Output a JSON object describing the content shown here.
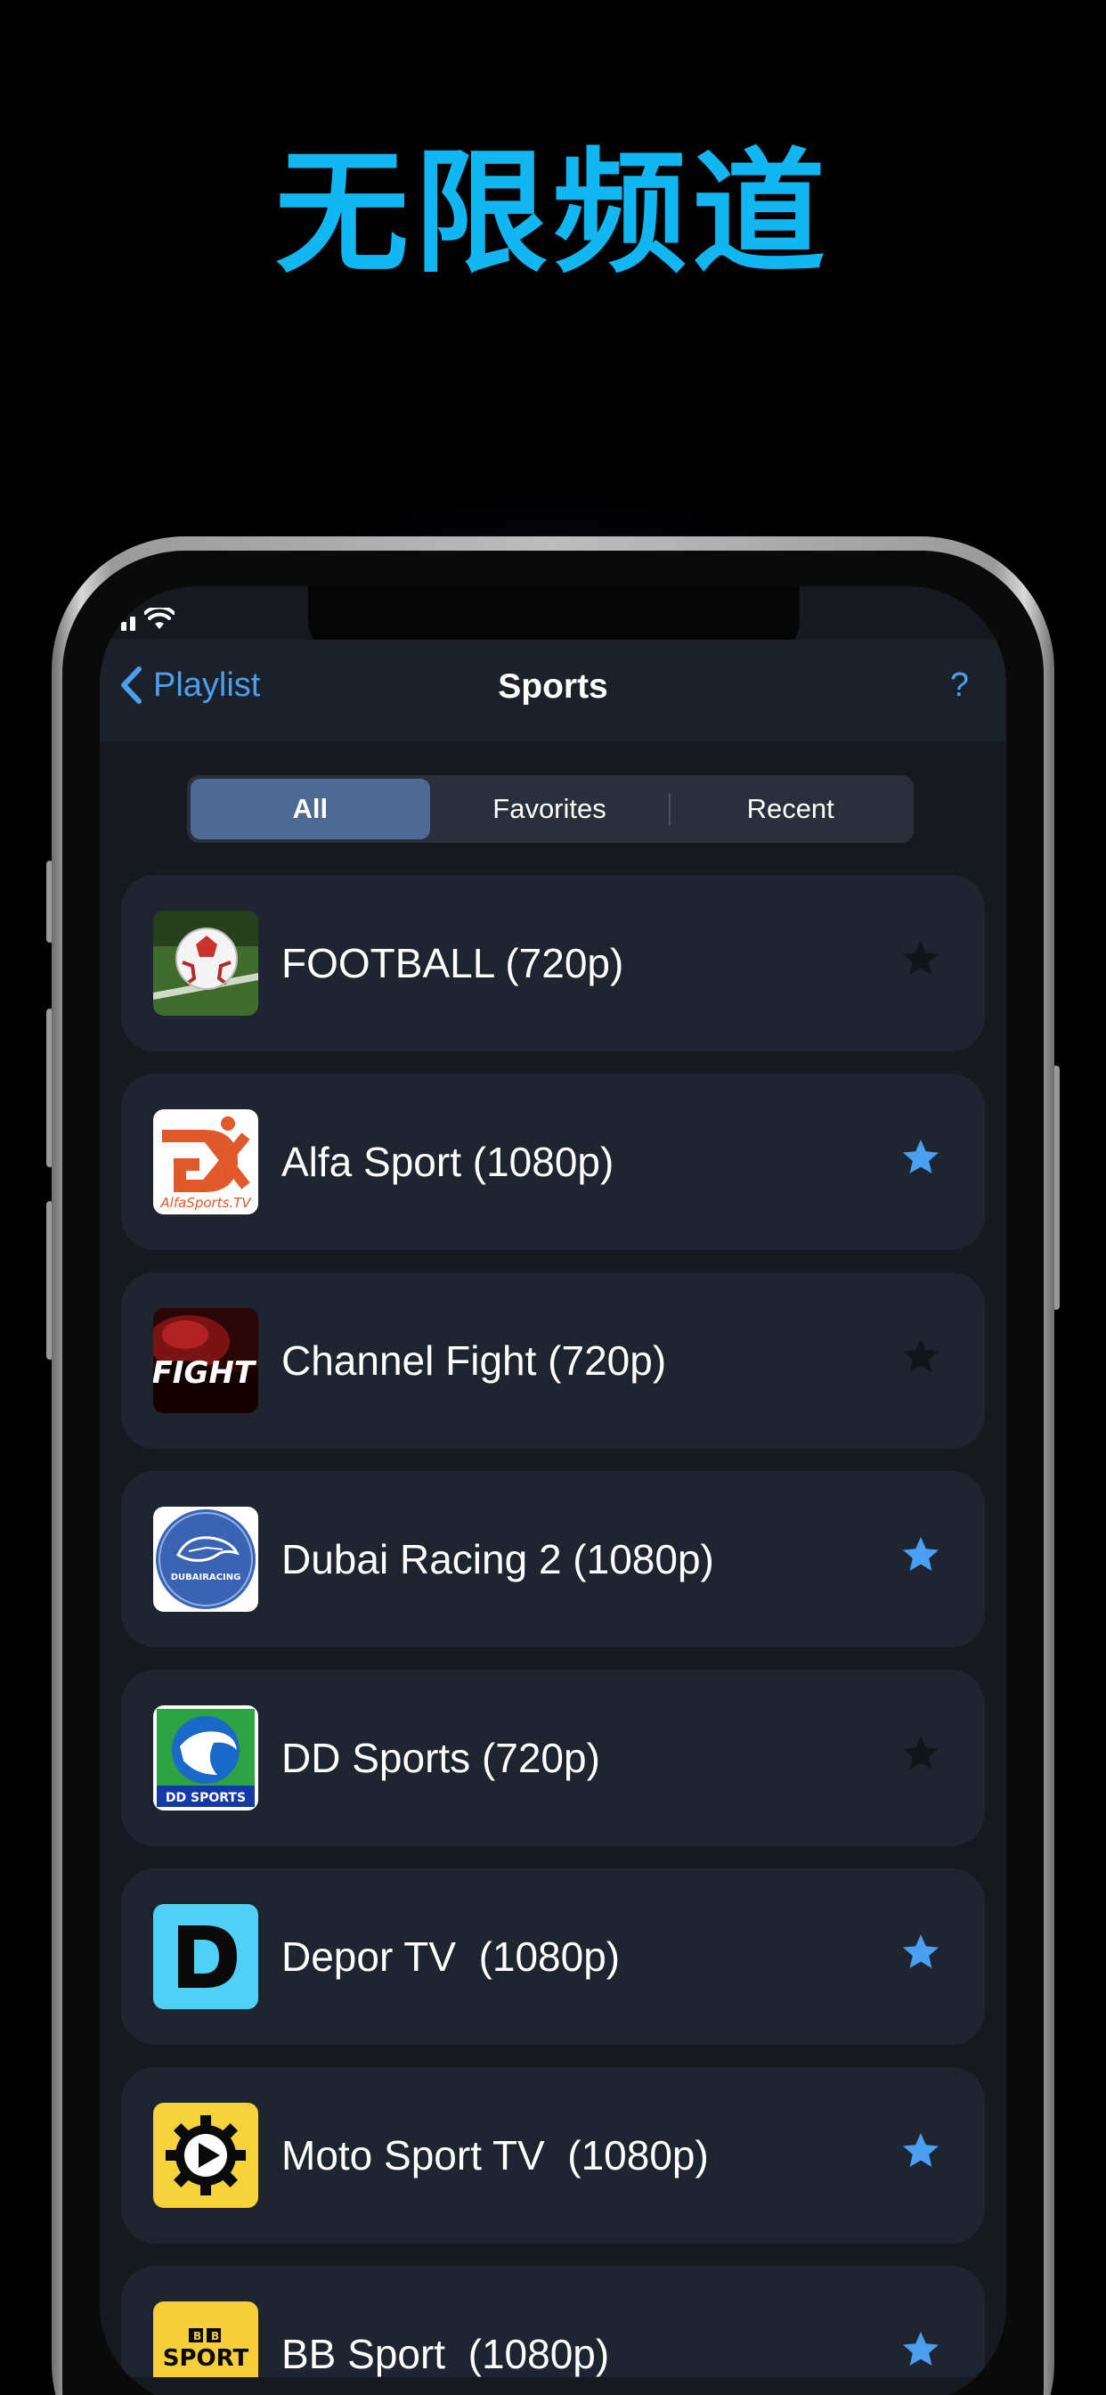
{
  "headline": "无限频道",
  "navbar": {
    "back_label": "Playlist",
    "title": "Sports",
    "help_label": "?"
  },
  "segments": {
    "items": [
      "All",
      "Favorites",
      "Recent"
    ],
    "selected": "All"
  },
  "channels": [
    {
      "name": "FOOTBALL (720p)",
      "favorite": false,
      "logo": "football-logo"
    },
    {
      "name": "Alfa Sport (1080p)",
      "favorite": true,
      "logo": "alfa-sport-logo",
      "logo_text": "AlfaSports.TV"
    },
    {
      "name": "Channel Fight (720p)",
      "favorite": false,
      "logo": "channel-fight-logo",
      "logo_text": "FIGHT"
    },
    {
      "name": "Dubai Racing 2 (1080p)",
      "favorite": true,
      "logo": "dubai-racing-logo",
      "logo_text": "DUBAIRACING"
    },
    {
      "name": "DD Sports (720p)",
      "favorite": false,
      "logo": "dd-sports-logo",
      "logo_text": "DD SPORTS"
    },
    {
      "name": "Depor TV  (1080p)",
      "favorite": true,
      "logo": "depor-tv-logo"
    },
    {
      "name": "Moto Sport TV  (1080p)",
      "favorite": true,
      "logo": "moto-sport-logo"
    },
    {
      "name": "BB Sport  (1080p)",
      "favorite": true,
      "logo": "bb-sport-logo",
      "logo_text": "SPORT"
    }
  ],
  "colors": {
    "accent": "#4b9ff0",
    "headline": "#12b7f2",
    "star_on": "#4b9ff0",
    "star_off": "#11151b"
  }
}
